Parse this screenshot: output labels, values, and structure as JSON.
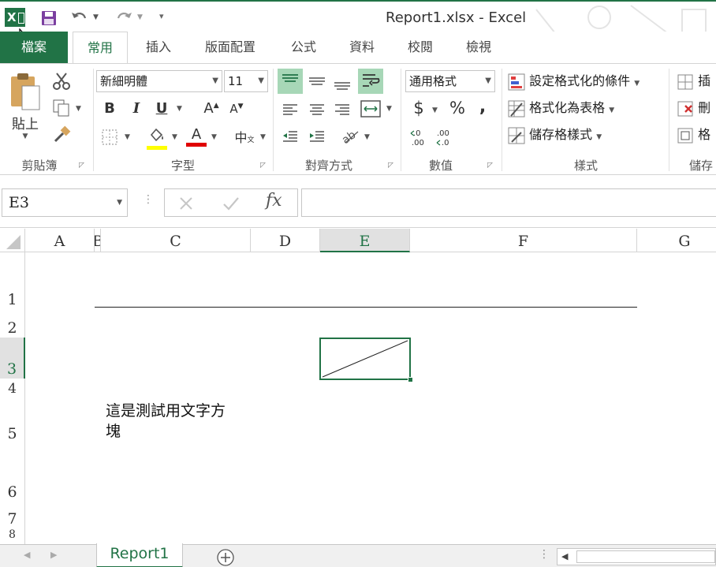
{
  "window": {
    "title": "Report1.xlsx - Excel",
    "app_icon": "X",
    "save_icon": "save-icon",
    "undo_icon": "undo-icon",
    "redo_icon": "redo-icon",
    "customize_icon": "customize-qat-icon"
  },
  "tabs": [
    {
      "label": "檔案"
    },
    {
      "label": "常用"
    },
    {
      "label": "插入"
    },
    {
      "label": "版面配置"
    },
    {
      "label": "公式"
    },
    {
      "label": "資料"
    },
    {
      "label": "校閱"
    },
    {
      "label": "檢視"
    }
  ],
  "ribbon": {
    "clipboard": {
      "paste_label": "貼上",
      "group_label": "剪貼簿"
    },
    "font": {
      "font_name": "新細明體",
      "font_size": "11",
      "bold": "B",
      "italic": "I",
      "underline": "U",
      "grow": "A",
      "shrink": "A",
      "font_color_letter": "A",
      "phonetic": "中",
      "group_label": "字型",
      "highlight_color": "#ffff00",
      "font_color": "#e00000"
    },
    "alignment": {
      "group_label": "對齊方式"
    },
    "number": {
      "format": "通用格式",
      "currency": "$",
      "percent": "%",
      "comma": ",",
      "inc_decimal": "←.0 .00",
      "dec_decimal": ".00 →.0",
      "group_label": "數值"
    },
    "styles": {
      "conditional": "設定格式化的條件",
      "as_table": "格式化為表格",
      "cell_styles": "儲存格樣式",
      "group_label": "樣式"
    },
    "cells": {
      "insert": "插",
      "delete": "刪",
      "format": "格",
      "group_label": "儲存"
    }
  },
  "formula_bar": {
    "name_box": "E3",
    "fx": "fx",
    "formula": ""
  },
  "columns": [
    "A",
    "B",
    "C",
    "D",
    "E",
    "F",
    "G"
  ],
  "rows": [
    "1",
    "2",
    "3",
    "4",
    "5",
    "6",
    "7",
    "8"
  ],
  "cell_text": "這是測試用文字方塊",
  "cell_text_line1": "這是測試用文字方",
  "cell_text_line2": "塊",
  "sheet": {
    "tab_label": "Report1",
    "add_icon": "plus-icon"
  },
  "accent_color": "#217346"
}
